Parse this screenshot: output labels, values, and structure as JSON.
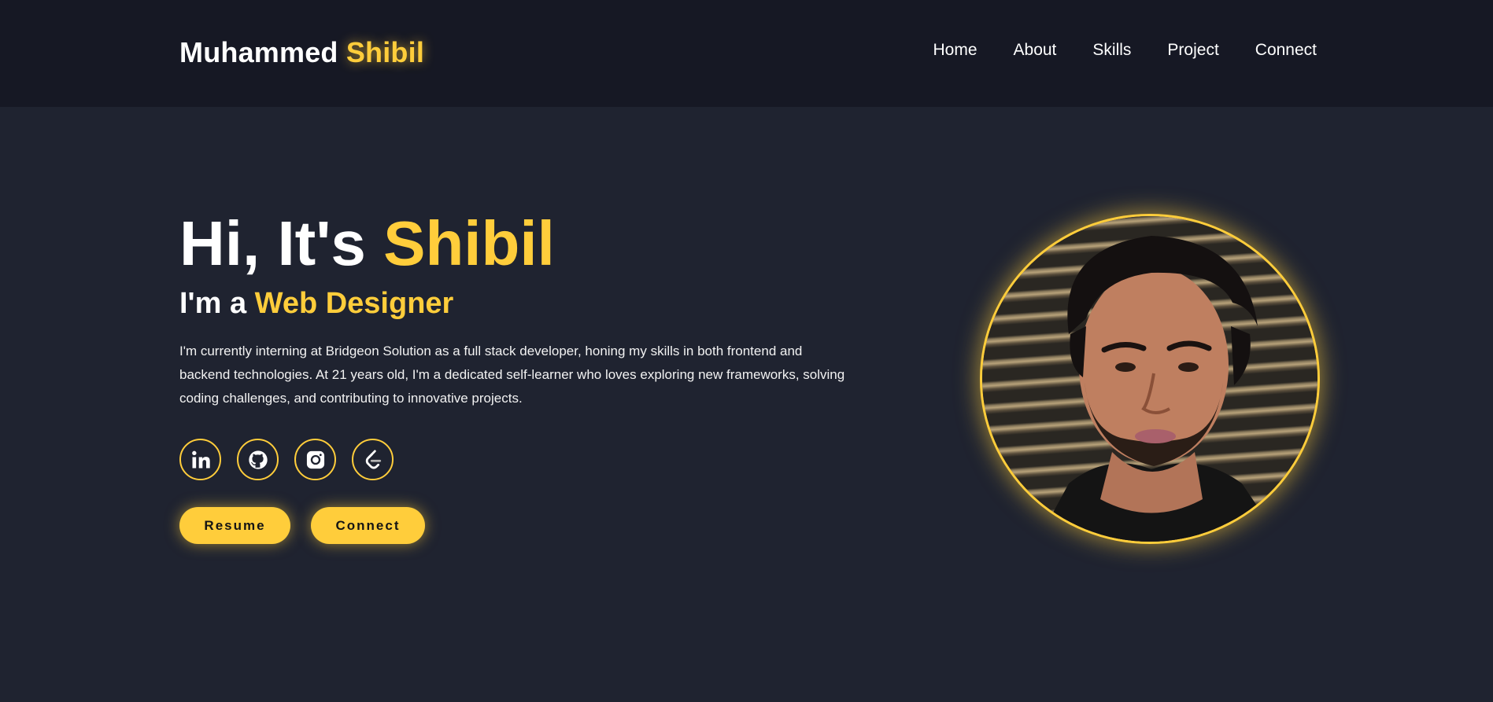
{
  "header": {
    "logo_first": "Muhammed",
    "logo_accent": "Shibil",
    "nav": [
      "Home",
      "About",
      "Skills",
      "Project",
      "Connect"
    ]
  },
  "hero": {
    "greeting": "Hi, It's",
    "name": "Shibil",
    "role_prefix": "I'm a",
    "role": "Web Designer",
    "bio": "I'm currently interning at Bridgeon Solution as a full stack developer, honing my skills in both frontend and backend technologies. At 21 years old, I'm a dedicated self-learner who loves exploring new frameworks, solving coding challenges, and contributing to innovative projects.",
    "socials": [
      "linkedin-icon",
      "github-icon",
      "instagram-icon",
      "leetcode-icon"
    ],
    "buttons": {
      "resume": "Resume",
      "connect": "Connect"
    }
  },
  "colors": {
    "accent": "#ffcd3b",
    "background": "#1f2330",
    "header": "#161824"
  }
}
